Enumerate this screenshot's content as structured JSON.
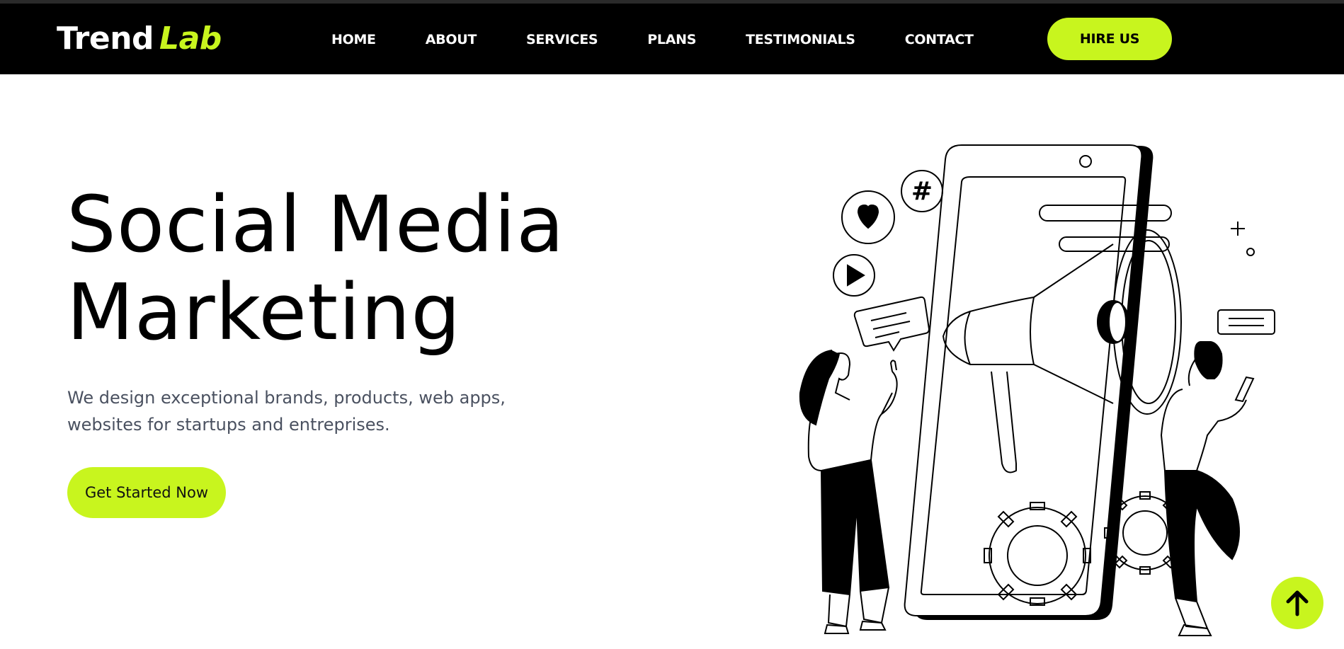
{
  "brand": {
    "name_main": "Trend",
    "name_accent": "Lab"
  },
  "nav": {
    "items": [
      {
        "label": "HOME"
      },
      {
        "label": "ABOUT"
      },
      {
        "label": "SERVICES"
      },
      {
        "label": "PLANS"
      },
      {
        "label": "TESTIMONIALS"
      },
      {
        "label": "CONTACT"
      }
    ],
    "hire_label": "HIRE US"
  },
  "hero": {
    "title_line1": "Social Media",
    "title_line2": "Marketing",
    "subtitle": "We design exceptional brands, products, web apps, websites for startups and entreprises.",
    "cta_label": "Get Started Now"
  },
  "colors": {
    "accent": "#c8f51e",
    "header_bg": "#000000",
    "text_muted": "#4a5160"
  },
  "icons": {
    "scroll_top": "arrow-up-icon",
    "illustration": "megaphone-phone-illustration"
  }
}
